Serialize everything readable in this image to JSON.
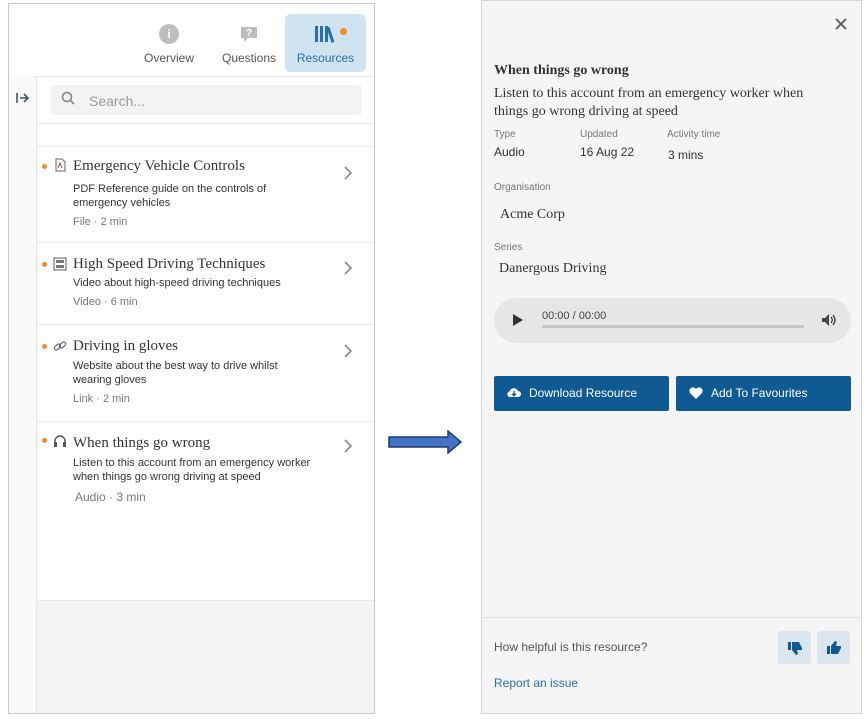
{
  "left": {
    "tabs": [
      {
        "label": "Overview",
        "icon": "info-icon"
      },
      {
        "label": "Questions",
        "icon": "question-bubble-icon"
      },
      {
        "label": "Resources",
        "icon": "books-icon",
        "active": true
      }
    ],
    "search": {
      "placeholder": "Search..."
    },
    "items": [
      {
        "title": "Emergency Vehicle Controls",
        "description": "PDF Reference guide on the controls of emergency vehicles",
        "meta": "File · 2 min",
        "icon": "pdf-file-icon"
      },
      {
        "title": "High Speed Driving Techniques",
        "description": "Video about high-speed driving techniques",
        "meta": "Video · 6 min",
        "icon": "film-icon"
      },
      {
        "title": "Driving in gloves",
        "description": "Website about the best way to drive whilst wearing gloves",
        "meta": "Link · 2 min",
        "icon": "link-icon"
      },
      {
        "title": "When things go wrong",
        "description": "Listen to this account from an emergency worker when things go wrong driving at speed",
        "meta": "Audio · 3 min",
        "icon": "headphones-icon"
      }
    ]
  },
  "detail": {
    "title": "When things go wrong",
    "description": "Listen to this account from an emergency worker when things go wrong driving at speed",
    "meta": [
      {
        "label": "Type",
        "value": "Audio"
      },
      {
        "label": "Updated",
        "value": "16 Aug 22"
      },
      {
        "label": "Activity time",
        "value": "3 mins"
      }
    ],
    "organisation_label": "Organisation",
    "organisation": "Acme Corp",
    "series_label": "Series",
    "series": "Danergous Driving",
    "audio": {
      "time": "00:00 / 00:00",
      "progress": 0
    },
    "buttons": {
      "download": "Download Resource",
      "favourite": "Add To Favourites"
    },
    "helpful_question": "How helpful is this resource?",
    "report_link": "Report an issue"
  },
  "colors": {
    "accent": "#0f5a92",
    "active_tab_bg": "#cfe3f1",
    "notification_dot": "#f28c28",
    "arrow_fill": "#4472c4"
  }
}
